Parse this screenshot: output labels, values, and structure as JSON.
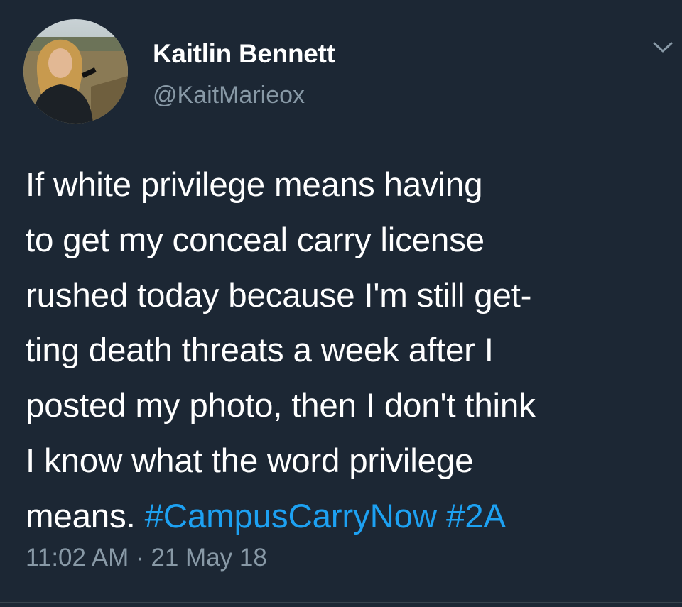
{
  "author": {
    "display_name": "Kaitlin Bennett",
    "handle": "@KaitMarieox"
  },
  "tweet": {
    "lines": [
      "If white privilege means having",
      "to get my conceal carry license",
      "rushed today because I'm still get-",
      "ting death threats a week after I",
      "posted my photo, then I don't think",
      "I know what the word privilege"
    ],
    "last_line_text": "means.",
    "hashtags": [
      "#CampusCarryNow",
      "#2A"
    ]
  },
  "meta": {
    "time": "11:02 AM",
    "separator": "·",
    "date": "21 May 18"
  },
  "icons": {
    "menu": "chevron-down-icon"
  },
  "colors": {
    "background": "#1c2734",
    "text": "#ffffff",
    "muted": "#8899a6",
    "link": "#1da1f2"
  }
}
